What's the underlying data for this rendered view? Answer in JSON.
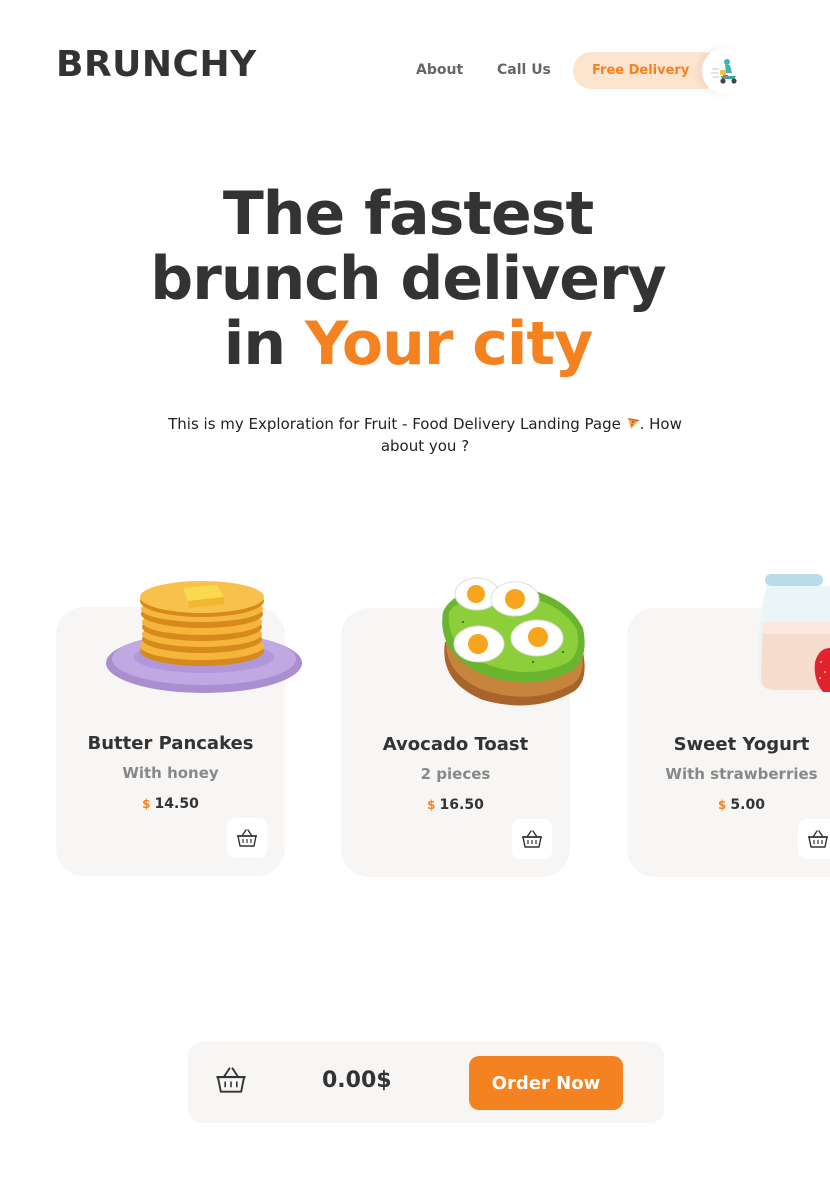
{
  "header": {
    "logo": "BRUNCHY",
    "nav": [
      {
        "label": "About"
      },
      {
        "label": "Call Us"
      }
    ],
    "delivery_label": "Free Delivery",
    "delivery_icon": "scooter-rider-icon"
  },
  "hero": {
    "line1": "The fastest",
    "line2": "brunch delivery",
    "line3_prefix": "in ",
    "line3_accent": "Your city",
    "subtitle_before": "This is my Exploration for Fruit - Food Delivery Landing Page ",
    "subtitle_after": ". How about you ?",
    "subtitle_icon": "pizza-icon"
  },
  "products": [
    {
      "name": "Butter Pancakes",
      "subtitle": "With honey",
      "currency": "$",
      "price": "14.50",
      "image": "pancakes-image"
    },
    {
      "name": "Avocado Toast",
      "subtitle": "2 pieces",
      "currency": "$",
      "price": "16.50",
      "image": "avocado-toast-image"
    },
    {
      "name": "Sweet Yogurt",
      "subtitle": "With strawberries",
      "currency": "$",
      "price": "5.00",
      "image": "yogurt-image"
    }
  ],
  "cart": {
    "total": "0.00$",
    "order_label": "Order Now",
    "icon": "basket-icon"
  },
  "colors": {
    "accent": "#f58220",
    "accent_light": "#fde4cf",
    "card_bg": "#f7f6f4",
    "text": "#333333"
  }
}
